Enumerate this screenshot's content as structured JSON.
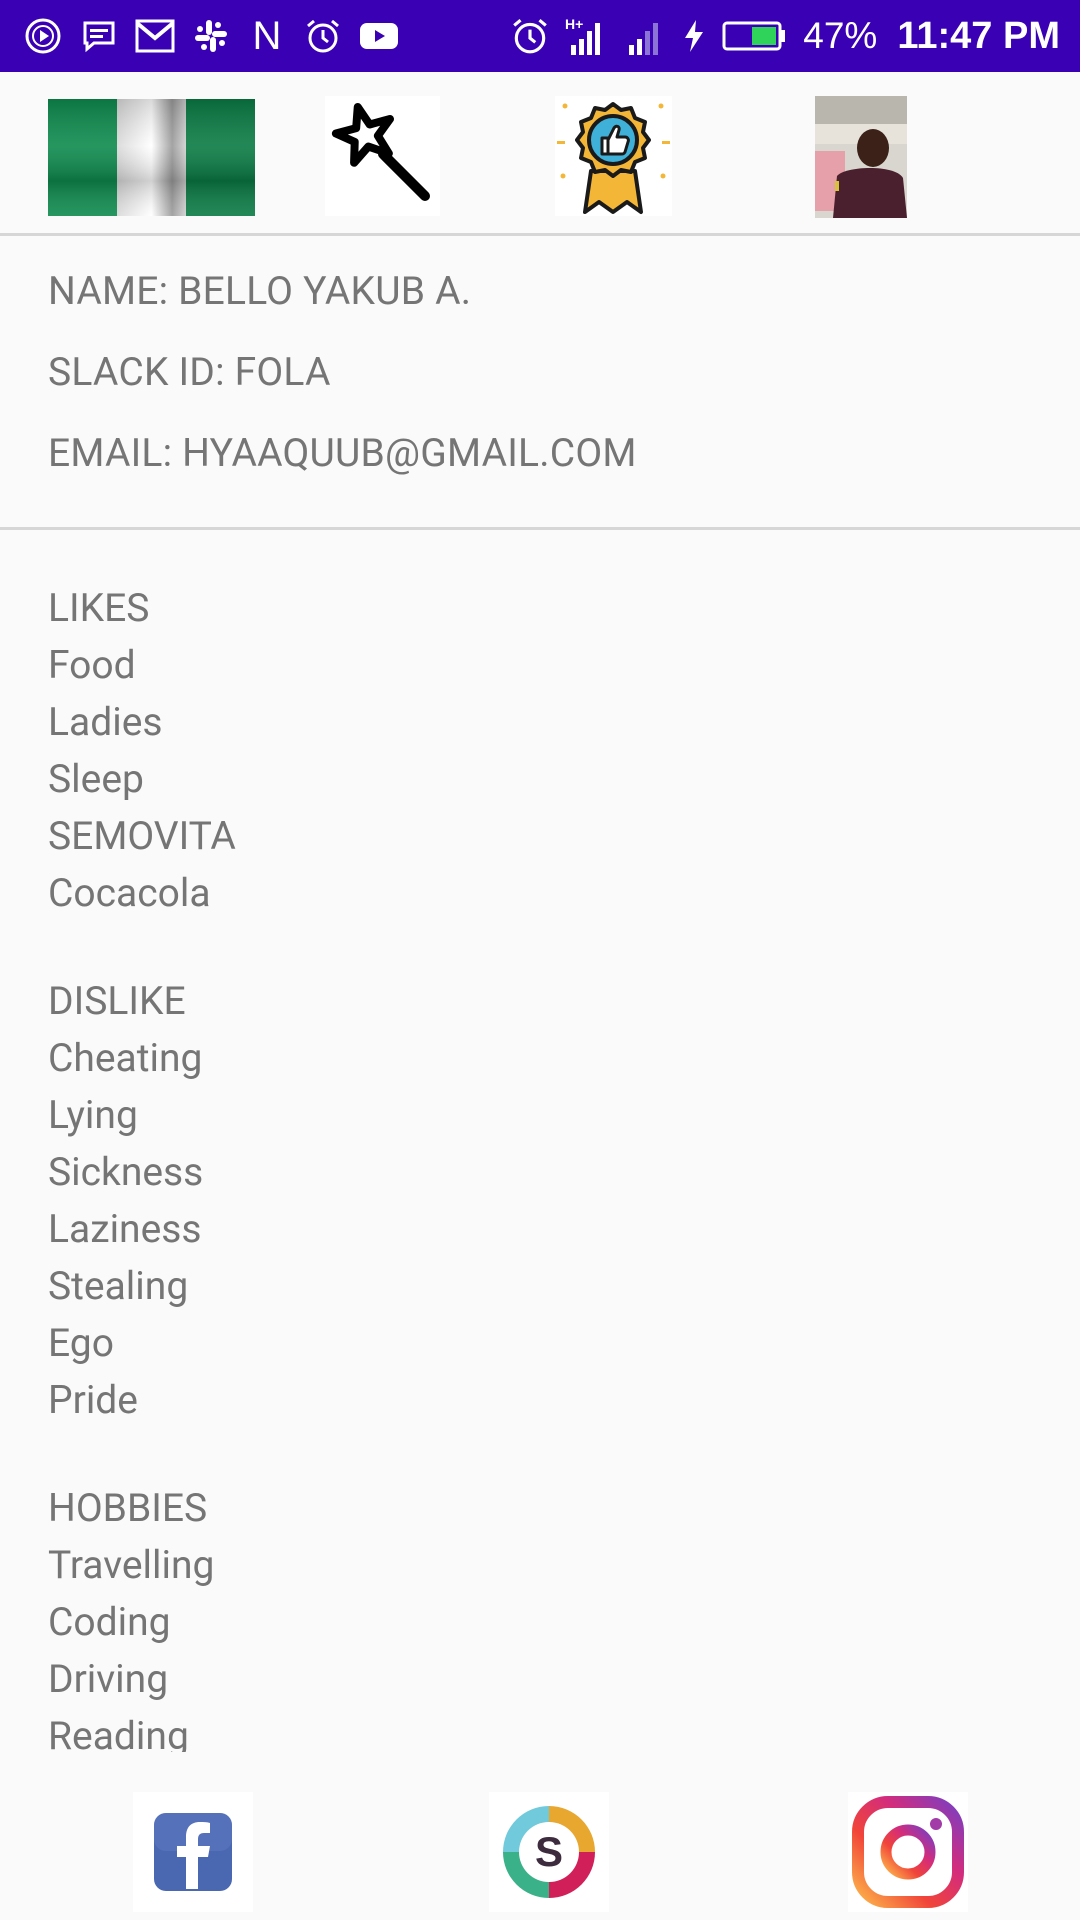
{
  "status_bar": {
    "battery_percent": "47%",
    "time": "11:47 PM",
    "network": "H+",
    "left_icons": [
      "play-icon",
      "message-icon",
      "gmail-icon",
      "slack-icon",
      "n-icon",
      "alarm-icon",
      "youtube-icon"
    ],
    "right_icons": [
      "alarm-icon",
      "signal-icon",
      "signal-icon",
      "charging-icon",
      "battery-icon"
    ],
    "color": "#3a00b3"
  },
  "profile": {
    "name": "NAME: BELLO YAKUB A.",
    "slack_id": "SLACK ID: FOLA",
    "email": "EMAIL: HYAAQUUB@GMAIL.COM"
  },
  "likes": {
    "title": "LIKES",
    "items": [
      "Food",
      "Ladies",
      "Sleep",
      "SEMOVITA",
      "Cocacola"
    ]
  },
  "dislikes": {
    "title": "DISLIKE",
    "items": [
      "Cheating",
      "Lying",
      "Sickness",
      "Laziness",
      "Stealing",
      "Ego",
      "Pride"
    ]
  },
  "hobbies": {
    "title": "HOBBIES",
    "items": [
      "Travelling",
      "Coding",
      "Driving",
      "Reading"
    ]
  },
  "top_icons": [
    "nigeria-flag-icon",
    "magic-wand-icon",
    "award-badge-icon",
    "profile-photo"
  ],
  "social_icons": [
    "facebook-icon",
    "slack-icon",
    "instagram-icon"
  ]
}
